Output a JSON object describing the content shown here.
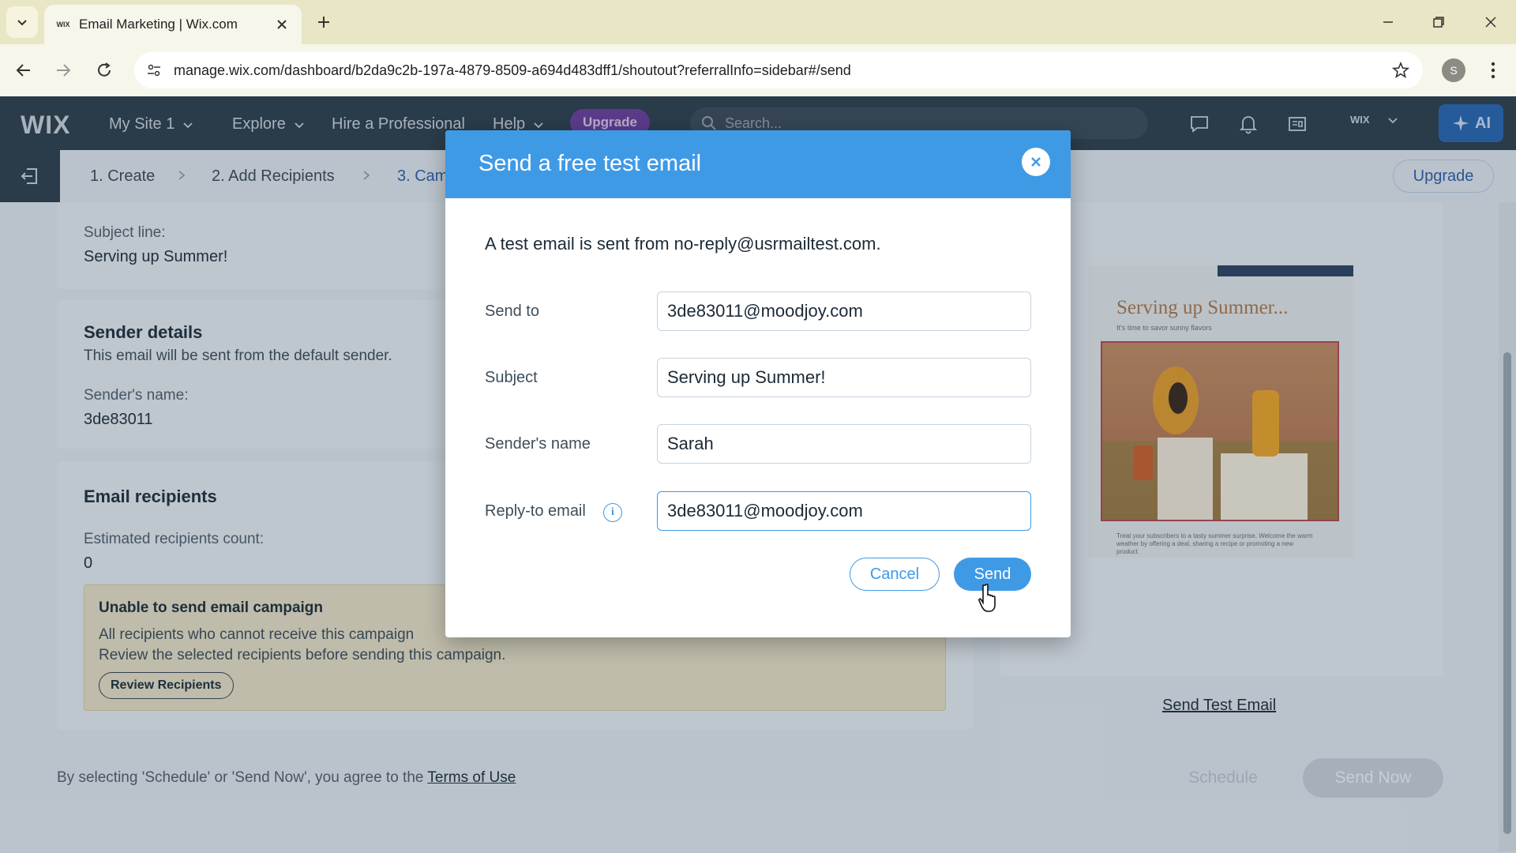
{
  "browser": {
    "tab_title": "Email Marketing | Wix.com",
    "tab_favicon": "WIX",
    "url": "manage.wix.com/dashboard/b2da9c2b-197a-4879-8509-a694d483dff1/shoutout?referralInfo=sidebar#/send",
    "profile_initial": "S"
  },
  "wix_header": {
    "logo": "WIX",
    "site_name": "My Site 1",
    "explore": "Explore",
    "hire": "Hire a Professional",
    "help": "Help",
    "upgrade": "Upgrade",
    "search_placeholder": "Search...",
    "account": "WIX",
    "ai_label": "AI"
  },
  "steps": {
    "items": [
      "1. Create",
      "2. Add Recipients",
      "3. Cam"
    ],
    "upgrade": "Upgrade"
  },
  "content": {
    "subject_label": "Subject line:",
    "subject_value": "Serving up Summer!",
    "sender_title": "Sender details",
    "sender_desc": "This email will be sent from the default sender.",
    "sender_name_label": "Sender's name:",
    "sender_name_value": "3de83011",
    "recipients_title": "Email recipients",
    "est_label": "Estimated recipients count:",
    "est_value": "0",
    "warning_title": "Unable to send email campaign",
    "warning_line1": "All recipients who cannot receive this campaign",
    "warning_line2": "Review the selected recipients before sending this campaign.",
    "review_button": "Review Recipients",
    "send_test_link": "Send Test Email",
    "footer_text": "By selecting 'Schedule' or 'Send Now', you agree to the",
    "footer_link": "Terms of Use",
    "schedule_button": "Schedule",
    "send_now_button": "Send Now"
  },
  "preview": {
    "headline": "Serving up Summer...",
    "subline": "It's time to savor sunny flavors",
    "caption": "Treat your subscribers to a tasty summer surprise. Welcome the warm weather by offering a deal, sharing a recipe or promoting a new product."
  },
  "modal": {
    "title": "Send a free test email",
    "intro": "A test email is sent from no-reply@usrmailtest.com.",
    "fields": {
      "send_to": {
        "label": "Send to",
        "value": "3de83011@moodjoy.com"
      },
      "subject": {
        "label": "Subject",
        "value": "Serving up Summer!"
      },
      "sender_name": {
        "label": "Sender's name",
        "value": "Sarah"
      },
      "reply_to": {
        "label": "Reply-to email",
        "value": "3de83011@moodjoy.com"
      }
    },
    "info_glyph": "i",
    "cancel": "Cancel",
    "send": "Send"
  },
  "colors": {
    "modal_header": "#3f9ae6",
    "wix_dark": "#2f3f4e",
    "upgrade_purple": "#6b3f9b",
    "warning_bg": "#e4dcc4"
  }
}
